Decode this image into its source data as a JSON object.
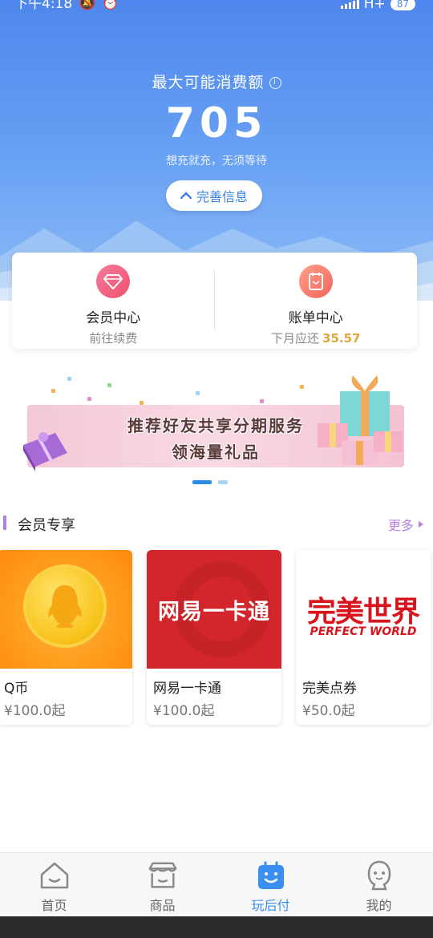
{
  "status_bar": {
    "time": "下午4:18",
    "network": "H+",
    "battery": "87"
  },
  "header": {
    "limit_label": "最大可能消费额",
    "limit_value": "705",
    "limit_subtitle": "想充就充，无须等待",
    "complete_button": "完善信息",
    "colors": {
      "gradient_top": "#4e86ee",
      "gradient_bottom": "#8dbbf6"
    }
  },
  "cards": [
    {
      "title": "会员中心",
      "subtitle": "前往续费",
      "amount": ""
    },
    {
      "title": "账单中心",
      "subtitle": "下月应还",
      "amount": "35.57"
    }
  ],
  "banner": {
    "line1": "推荐好友共享分期服务",
    "line2": "领海量礼品",
    "carousel": {
      "total": 2,
      "active": 1
    }
  },
  "section": {
    "title": "会员专享",
    "more": "更多"
  },
  "products": [
    {
      "name": "Q币",
      "price": "¥100.0起",
      "image": "qq-coin"
    },
    {
      "name": "网易一卡通",
      "price": "¥100.0起",
      "image_text": "网易一卡通"
    },
    {
      "name": "完美点券",
      "price": "¥50.0起",
      "image_text_cn": "完美世界",
      "image_text_en": "PERFECT WORLD"
    }
  ],
  "bottom_nav": [
    {
      "label": "首页",
      "icon": "home-icon",
      "active": false
    },
    {
      "label": "商品",
      "icon": "store-icon",
      "active": false
    },
    {
      "label": "玩后付",
      "icon": "bag-icon",
      "active": true
    },
    {
      "label": "我的",
      "icon": "profile-icon",
      "active": false
    }
  ],
  "accent_colors": {
    "primary": "#3b8ff0",
    "purple": "#b77fe0",
    "amount": "#e0a83a"
  }
}
